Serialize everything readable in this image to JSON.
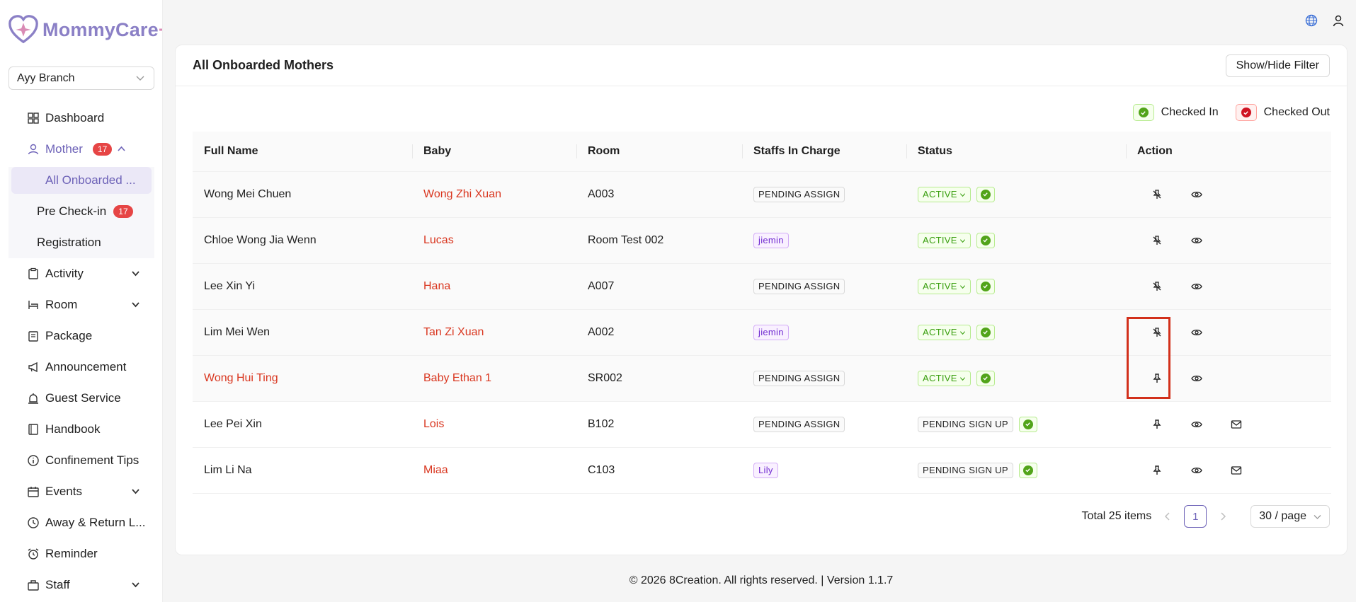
{
  "app": {
    "name": "MommyCare",
    "plus": "+"
  },
  "branch": {
    "selected": "Ayy Branch"
  },
  "sidebar": {
    "items": [
      {
        "label": "Dashboard",
        "icon": "dashboard-icon"
      },
      {
        "label": "Mother",
        "icon": "user-icon",
        "badge": "17"
      },
      {
        "label": "Activity",
        "icon": "clipboard-icon"
      },
      {
        "label": "Room",
        "icon": "bed-icon"
      },
      {
        "label": "Package",
        "icon": "package-icon"
      },
      {
        "label": "Announcement",
        "icon": "megaphone-icon"
      },
      {
        "label": "Guest Service",
        "icon": "bell-icon"
      },
      {
        "label": "Handbook",
        "icon": "book-icon"
      },
      {
        "label": "Confinement Tips",
        "icon": "info-icon"
      },
      {
        "label": "Events",
        "icon": "calendar-icon"
      },
      {
        "label": "Away & Return L...",
        "icon": "clock-icon"
      },
      {
        "label": "Reminder",
        "icon": "alarm-icon"
      },
      {
        "label": "Staff",
        "icon": "staff-icon"
      }
    ],
    "submenu": [
      {
        "label": "All Onboarded ..."
      },
      {
        "label": "Pre Check-in",
        "badge": "17"
      },
      {
        "label": "Registration"
      }
    ]
  },
  "card": {
    "title": "All Onboarded Mothers",
    "filter_button": "Show/Hide Filter"
  },
  "legend": {
    "checked_in": "Checked In",
    "checked_out": "Checked Out"
  },
  "table": {
    "headers": [
      "Full Name",
      "Baby",
      "Room",
      "Staffs In Charge",
      "Status",
      "Action"
    ],
    "rows": [
      {
        "name": "Wong Mei Chuen",
        "baby": "Wong Zhi Xuan",
        "room": "A003",
        "staff": "PENDING ASSIGN",
        "status": "ACTIVE"
      },
      {
        "name": "Chloe Wong Jia Wenn",
        "baby": "Lucas",
        "room": "Room Test 002",
        "staff": "jiemin",
        "status": "ACTIVE"
      },
      {
        "name": "Lee Xin Yi",
        "baby": "Hana",
        "room": "A007",
        "staff": "PENDING ASSIGN",
        "status": "ACTIVE"
      },
      {
        "name": "Lim Mei Wen",
        "baby": "Tan Zi Xuan",
        "room": "A002",
        "staff": "jiemin",
        "status": "ACTIVE"
      },
      {
        "name": "Wong Hui Ting",
        "baby": "Baby Ethan 1",
        "room": "SR002",
        "staff": "PENDING ASSIGN",
        "status": "ACTIVE"
      },
      {
        "name": "Lee Pei Xin",
        "baby": "Lois",
        "room": "B102",
        "staff": "PENDING ASSIGN",
        "status": "PENDING SIGN UP"
      },
      {
        "name": "Lim Li Na",
        "baby": "Miaa",
        "room": "C103",
        "staff": "Lily",
        "status": "PENDING SIGN UP"
      }
    ]
  },
  "pagination": {
    "total": "Total 25 items",
    "current": "1",
    "page_size": "30 / page"
  },
  "footer": "© 2026 8Creation. All rights reserved. | Version 1.1.7"
}
